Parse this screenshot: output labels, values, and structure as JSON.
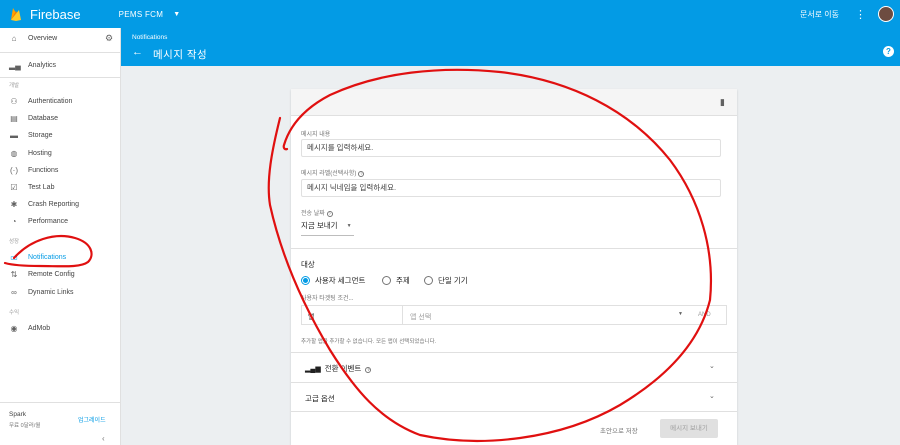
{
  "topbar": {
    "brand": "Firebase",
    "project": "PEMS FCM",
    "docs_link": "문서로 이동",
    "colors": {
      "bar": "#039be5",
      "logo": "#ffca28"
    }
  },
  "sidebar": {
    "overview": "Overview",
    "analytics": "Analytics",
    "section_develop": "개발",
    "develop_items": [
      "Authentication",
      "Database",
      "Storage",
      "Hosting",
      "Functions",
      "Test Lab",
      "Crash Reporting",
      "Performance"
    ],
    "section_grow": "성장",
    "grow_items": [
      "Notifications",
      "Remote Config",
      "Dynamic Links"
    ],
    "section_earn": "수익",
    "earn_items": [
      "AdMob"
    ],
    "plan_name": "Spark",
    "plan_price": "무료 0달러/월",
    "upgrade": "업그레이드",
    "active_item": "Notifications"
  },
  "header": {
    "breadcrumb": "Notifications",
    "title": "메시지 작성"
  },
  "form": {
    "message_label": "메시지 내용",
    "message_placeholder": "메시지를 입력하세요.",
    "label_label": "메시지 라벨(선택사항)",
    "label_placeholder": "메시지 닉네임을 입력하세요.",
    "send_date_label": "전송 날짜",
    "send_date_value": "지금 보내기",
    "target_title": "대상",
    "target_options": [
      "사용자 세그먼트",
      "주제",
      "단일 기기"
    ],
    "target_selected": "사용자 세그먼트",
    "targeting_label": "사용자 타겟팅 조건...",
    "condition_app": "앱",
    "condition_select_placeholder": "앱 선택",
    "condition_and": "AND",
    "note": "추가할 앱을 추가할 수 없습니다. 모든 앱이 선택되었습니다.",
    "conversion_events": "전환 이벤트",
    "advanced_options": "고급 옵션",
    "save_draft": "초안으로 저장",
    "send_message": "메시지 보내기"
  },
  "annotation": {
    "scribble_color": "#e01010"
  }
}
